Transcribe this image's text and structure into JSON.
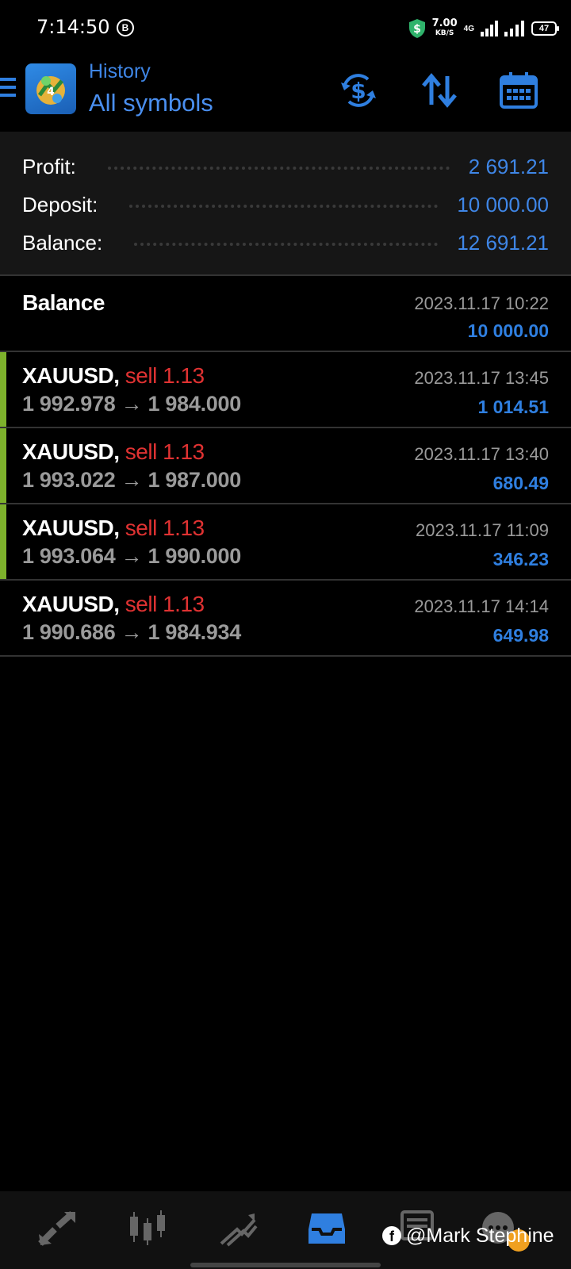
{
  "status_bar": {
    "time": "7:14:50",
    "b_badge": "B",
    "speed_value": "7.00",
    "speed_unit": "KB/S",
    "network": "4G",
    "battery": "47"
  },
  "header": {
    "title": "History",
    "subtitle": "All symbols",
    "accent_color": "#2f7fe0"
  },
  "summary": [
    {
      "label": "Profit:",
      "value": "2 691.21"
    },
    {
      "label": "Deposit:",
      "value": "10 000.00"
    },
    {
      "label": "Balance:",
      "value": "12 691.21"
    }
  ],
  "balance_entry": {
    "label": "Balance",
    "time": "2023.11.17 10:22",
    "amount": "10 000.00"
  },
  "trades": [
    {
      "symbol": "XAUUSD,",
      "side": "sell 1.13",
      "prices": "1 992.978 → 1 984.000",
      "time": "2023.11.17 13:45",
      "profit": "1 014.51",
      "accent": true
    },
    {
      "symbol": "XAUUSD,",
      "side": "sell 1.13",
      "prices": "1 993.022 → 1 987.000",
      "time": "2023.11.17 13:40",
      "profit": "680.49",
      "accent": true
    },
    {
      "symbol": "XAUUSD,",
      "side": "sell 1.13",
      "prices": "1 993.064 → 1 990.000",
      "time": "2023.11.17 11:09",
      "profit": "346.23",
      "accent": true
    },
    {
      "symbol": "XAUUSD,",
      "side": "sell 1.13",
      "prices": "1 990.686 → 1 984.934",
      "time": "2023.11.17 14:14",
      "profit": "649.98",
      "accent": false
    }
  ],
  "bottom_nav": [
    {
      "icon": "quotes-icon"
    },
    {
      "icon": "chart-icon"
    },
    {
      "icon": "trade-icon"
    },
    {
      "icon": "history-icon",
      "active": true
    },
    {
      "icon": "messages-icon"
    },
    {
      "icon": "chat-icon"
    }
  ],
  "watermark": {
    "text": "@Mark Stephine",
    "fb_glyph": "f"
  }
}
